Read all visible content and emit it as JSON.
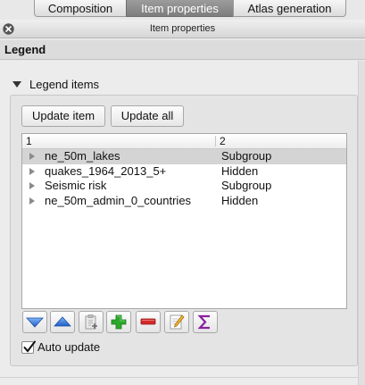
{
  "tabs": [
    {
      "label": "Composition"
    },
    {
      "label": "Item properties"
    },
    {
      "label": "Atlas generation"
    }
  ],
  "dock": {
    "title": "Item properties"
  },
  "section": {
    "title": "Legend"
  },
  "group": {
    "title": "Legend items"
  },
  "buttons": {
    "update_item": "Update item",
    "update_all": "Update all"
  },
  "tree": {
    "columns": [
      "1",
      "2"
    ],
    "rows": [
      {
        "name": "ne_50m_lakes",
        "kind": "Subgroup",
        "selected": true
      },
      {
        "name": "quakes_1964_2013_5+",
        "kind": "Hidden",
        "selected": false
      },
      {
        "name": "Seismic risk",
        "kind": "Subgroup",
        "selected": false
      },
      {
        "name": "ne_50m_admin_0_countries",
        "kind": "Hidden",
        "selected": false
      }
    ]
  },
  "toolbar": {
    "icons": [
      "move-down-icon",
      "move-up-icon",
      "add-group-icon",
      "add-item-icon",
      "remove-item-icon",
      "edit-item-icon",
      "count-features-icon"
    ]
  },
  "auto_update": {
    "label": "Auto update",
    "checked": true
  },
  "colors": {
    "selected_row": "#d4d4d4",
    "active_tab": "#8a8a8a",
    "add_green": "#2ca82c",
    "remove_red": "#d42a2a",
    "sigma_purple": "#8a1fa0",
    "arrow_blue": "#2a6fd6"
  }
}
